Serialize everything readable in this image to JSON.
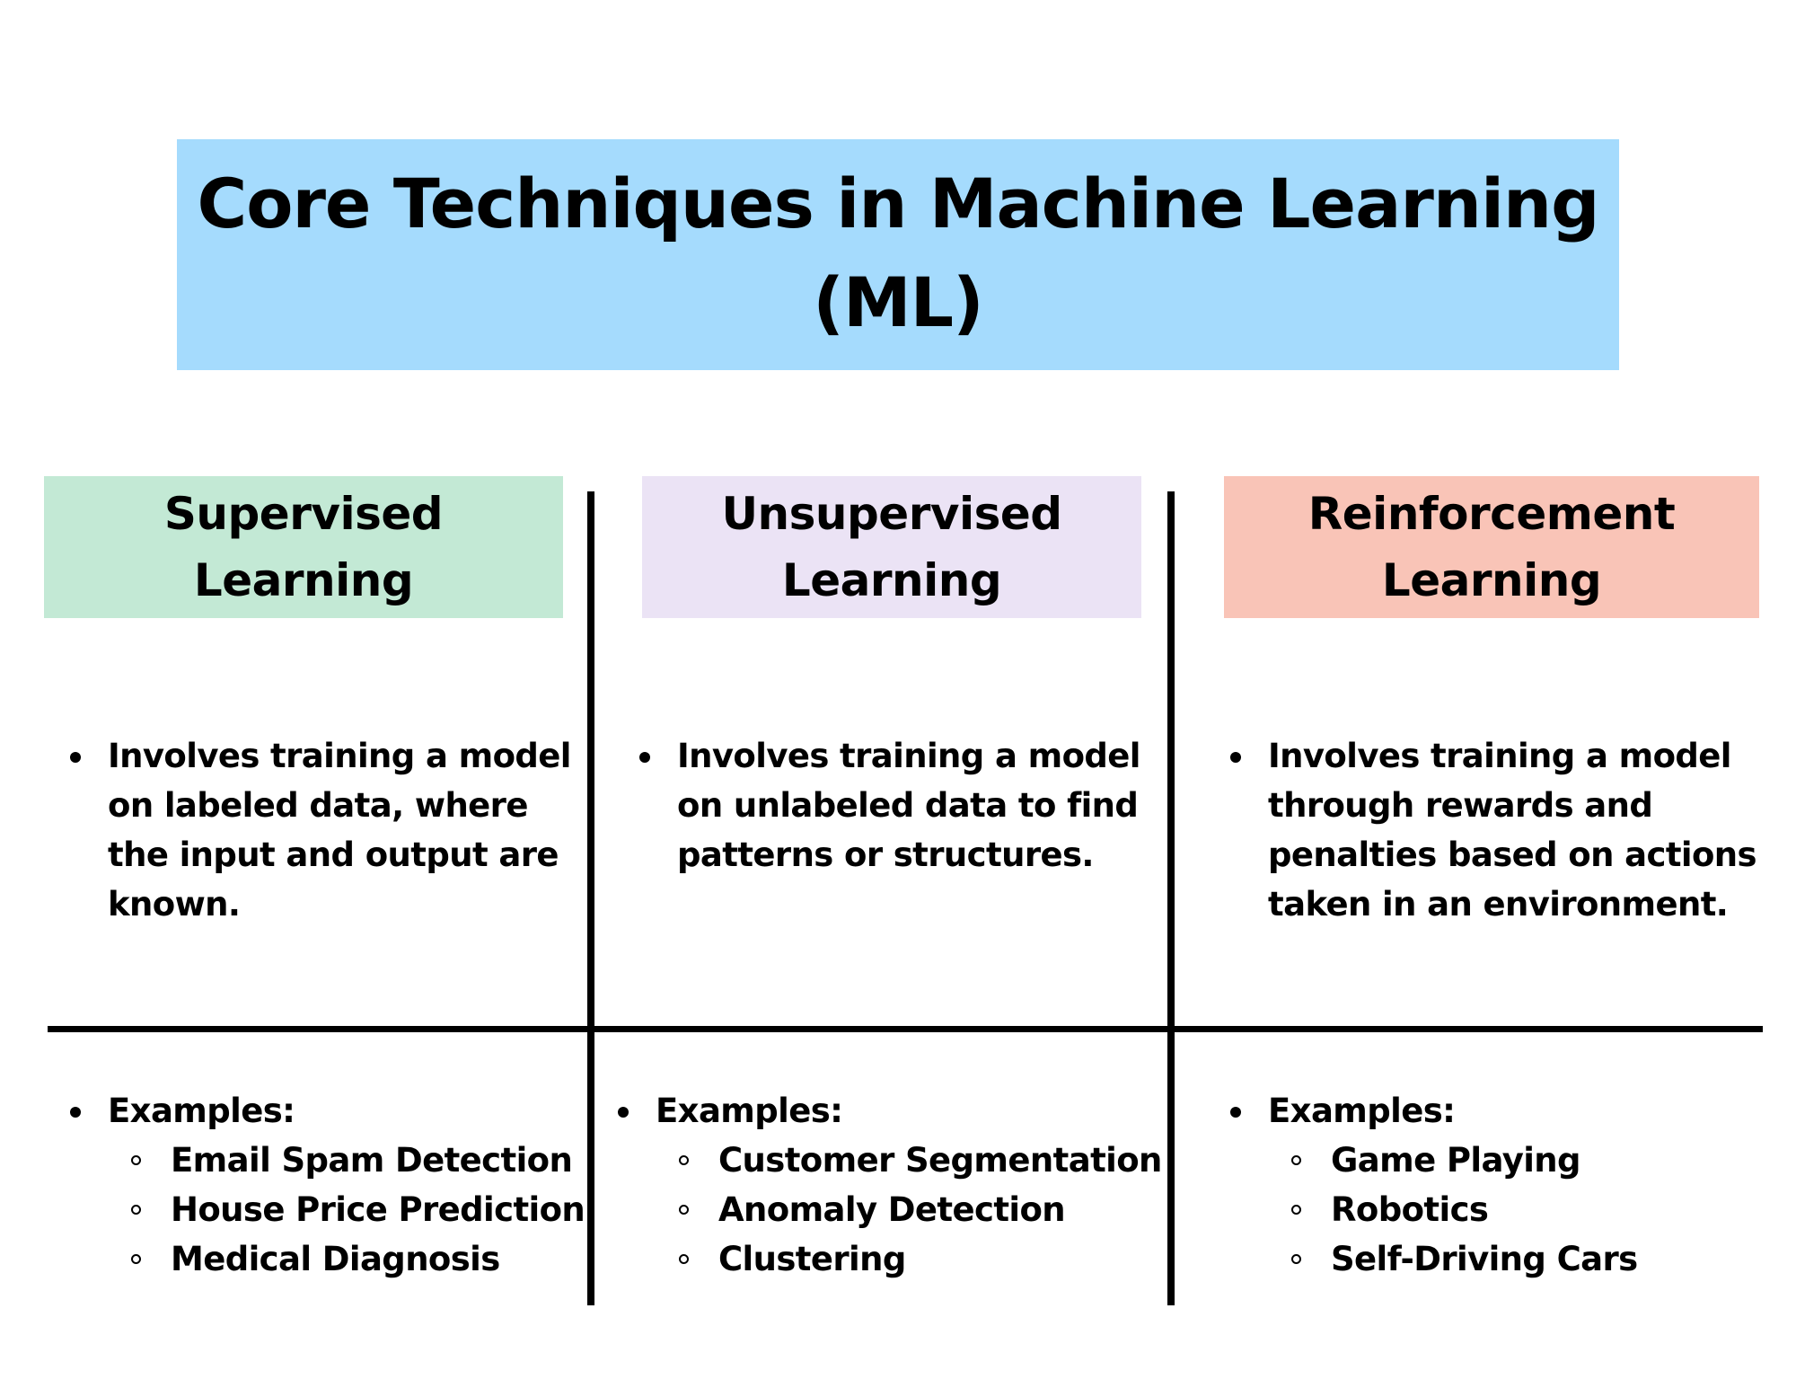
{
  "title": {
    "line1": "Core Techniques in Machine Learning",
    "line2": "(ML)",
    "background_color": "#A5DBFD"
  },
  "columns": [
    {
      "id": "supervised",
      "header_line1": "Supervised",
      "header_line2": "Learning",
      "header_color": "#C3E9D5",
      "description": "Involves training a model on labeled data, where the input and output are known.",
      "examples_label": "Examples:",
      "examples": [
        "Email Spam Detection",
        "House Price Prediction",
        "Medical Diagnosis"
      ]
    },
    {
      "id": "unsupervised",
      "header_line1": "Unsupervised",
      "header_line2": "Learning",
      "header_color": "#EBE3F5",
      "description": "Involves training a model on unlabeled data to find patterns or structures.",
      "examples_label": "Examples:",
      "examples": [
        "Customer Segmentation",
        "Anomaly Detection",
        "Clustering"
      ]
    },
    {
      "id": "reinforcement",
      "header_line1": "Reinforcement",
      "header_line2": "Learning",
      "header_color": "#F9C4B7",
      "description": "Involves training a model through rewards and penalties based on actions taken in an environment.",
      "examples_label": "Examples:",
      "examples": [
        "Game Playing",
        "Robotics",
        "Self-Driving Cars"
      ]
    }
  ],
  "icons": {
    "bullet": "filled-circle-bullet",
    "sub_bullet": "hollow-circle-bullet"
  }
}
